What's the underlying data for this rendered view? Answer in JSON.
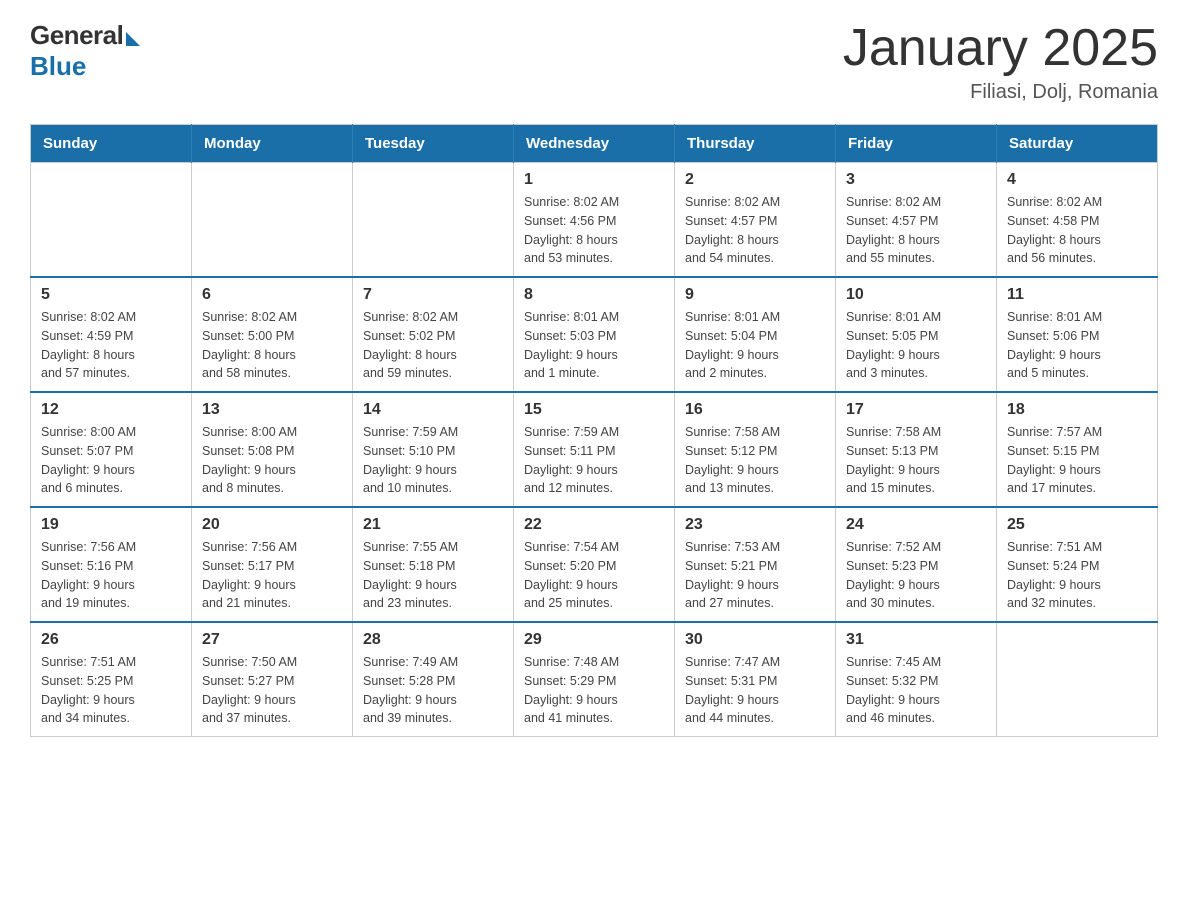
{
  "logo": {
    "general": "General",
    "blue": "Blue"
  },
  "title": "January 2025",
  "subtitle": "Filiasi, Dolj, Romania",
  "days": [
    "Sunday",
    "Monday",
    "Tuesday",
    "Wednesday",
    "Thursday",
    "Friday",
    "Saturday"
  ],
  "weeks": [
    [
      {
        "day": "",
        "info": ""
      },
      {
        "day": "",
        "info": ""
      },
      {
        "day": "",
        "info": ""
      },
      {
        "day": "1",
        "info": "Sunrise: 8:02 AM\nSunset: 4:56 PM\nDaylight: 8 hours\nand 53 minutes."
      },
      {
        "day": "2",
        "info": "Sunrise: 8:02 AM\nSunset: 4:57 PM\nDaylight: 8 hours\nand 54 minutes."
      },
      {
        "day": "3",
        "info": "Sunrise: 8:02 AM\nSunset: 4:57 PM\nDaylight: 8 hours\nand 55 minutes."
      },
      {
        "day": "4",
        "info": "Sunrise: 8:02 AM\nSunset: 4:58 PM\nDaylight: 8 hours\nand 56 minutes."
      }
    ],
    [
      {
        "day": "5",
        "info": "Sunrise: 8:02 AM\nSunset: 4:59 PM\nDaylight: 8 hours\nand 57 minutes."
      },
      {
        "day": "6",
        "info": "Sunrise: 8:02 AM\nSunset: 5:00 PM\nDaylight: 8 hours\nand 58 minutes."
      },
      {
        "day": "7",
        "info": "Sunrise: 8:02 AM\nSunset: 5:02 PM\nDaylight: 8 hours\nand 59 minutes."
      },
      {
        "day": "8",
        "info": "Sunrise: 8:01 AM\nSunset: 5:03 PM\nDaylight: 9 hours\nand 1 minute."
      },
      {
        "day": "9",
        "info": "Sunrise: 8:01 AM\nSunset: 5:04 PM\nDaylight: 9 hours\nand 2 minutes."
      },
      {
        "day": "10",
        "info": "Sunrise: 8:01 AM\nSunset: 5:05 PM\nDaylight: 9 hours\nand 3 minutes."
      },
      {
        "day": "11",
        "info": "Sunrise: 8:01 AM\nSunset: 5:06 PM\nDaylight: 9 hours\nand 5 minutes."
      }
    ],
    [
      {
        "day": "12",
        "info": "Sunrise: 8:00 AM\nSunset: 5:07 PM\nDaylight: 9 hours\nand 6 minutes."
      },
      {
        "day": "13",
        "info": "Sunrise: 8:00 AM\nSunset: 5:08 PM\nDaylight: 9 hours\nand 8 minutes."
      },
      {
        "day": "14",
        "info": "Sunrise: 7:59 AM\nSunset: 5:10 PM\nDaylight: 9 hours\nand 10 minutes."
      },
      {
        "day": "15",
        "info": "Sunrise: 7:59 AM\nSunset: 5:11 PM\nDaylight: 9 hours\nand 12 minutes."
      },
      {
        "day": "16",
        "info": "Sunrise: 7:58 AM\nSunset: 5:12 PM\nDaylight: 9 hours\nand 13 minutes."
      },
      {
        "day": "17",
        "info": "Sunrise: 7:58 AM\nSunset: 5:13 PM\nDaylight: 9 hours\nand 15 minutes."
      },
      {
        "day": "18",
        "info": "Sunrise: 7:57 AM\nSunset: 5:15 PM\nDaylight: 9 hours\nand 17 minutes."
      }
    ],
    [
      {
        "day": "19",
        "info": "Sunrise: 7:56 AM\nSunset: 5:16 PM\nDaylight: 9 hours\nand 19 minutes."
      },
      {
        "day": "20",
        "info": "Sunrise: 7:56 AM\nSunset: 5:17 PM\nDaylight: 9 hours\nand 21 minutes."
      },
      {
        "day": "21",
        "info": "Sunrise: 7:55 AM\nSunset: 5:18 PM\nDaylight: 9 hours\nand 23 minutes."
      },
      {
        "day": "22",
        "info": "Sunrise: 7:54 AM\nSunset: 5:20 PM\nDaylight: 9 hours\nand 25 minutes."
      },
      {
        "day": "23",
        "info": "Sunrise: 7:53 AM\nSunset: 5:21 PM\nDaylight: 9 hours\nand 27 minutes."
      },
      {
        "day": "24",
        "info": "Sunrise: 7:52 AM\nSunset: 5:23 PM\nDaylight: 9 hours\nand 30 minutes."
      },
      {
        "day": "25",
        "info": "Sunrise: 7:51 AM\nSunset: 5:24 PM\nDaylight: 9 hours\nand 32 minutes."
      }
    ],
    [
      {
        "day": "26",
        "info": "Sunrise: 7:51 AM\nSunset: 5:25 PM\nDaylight: 9 hours\nand 34 minutes."
      },
      {
        "day": "27",
        "info": "Sunrise: 7:50 AM\nSunset: 5:27 PM\nDaylight: 9 hours\nand 37 minutes."
      },
      {
        "day": "28",
        "info": "Sunrise: 7:49 AM\nSunset: 5:28 PM\nDaylight: 9 hours\nand 39 minutes."
      },
      {
        "day": "29",
        "info": "Sunrise: 7:48 AM\nSunset: 5:29 PM\nDaylight: 9 hours\nand 41 minutes."
      },
      {
        "day": "30",
        "info": "Sunrise: 7:47 AM\nSunset: 5:31 PM\nDaylight: 9 hours\nand 44 minutes."
      },
      {
        "day": "31",
        "info": "Sunrise: 7:45 AM\nSunset: 5:32 PM\nDaylight: 9 hours\nand 46 minutes."
      },
      {
        "day": "",
        "info": ""
      }
    ]
  ]
}
